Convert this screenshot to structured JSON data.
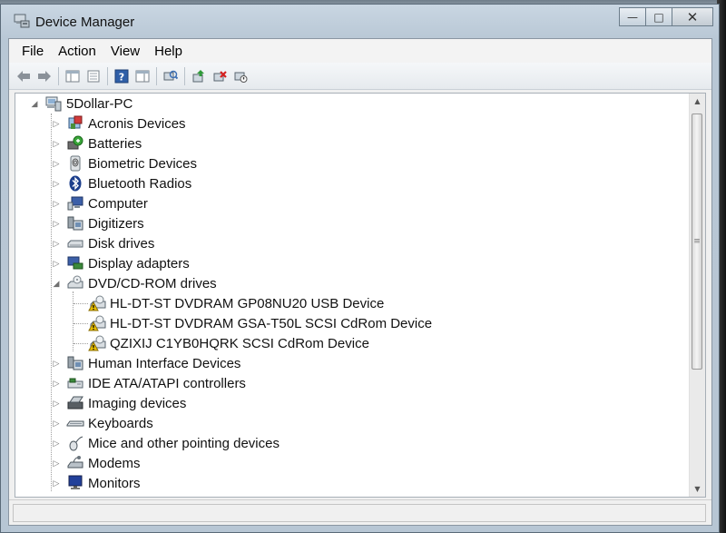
{
  "window": {
    "title": "Device Manager",
    "minimize_glyph": "—",
    "maximize_glyph": "□",
    "close_glyph": "✕"
  },
  "menubar": {
    "items": [
      "File",
      "Action",
      "View",
      "Help"
    ]
  },
  "toolbar": {
    "buttons": [
      {
        "icon": "back-arrow-icon"
      },
      {
        "icon": "forward-arrow-icon"
      },
      {
        "icon": "show-hide-console-tree-icon"
      },
      {
        "icon": "properties-icon"
      },
      {
        "icon": "help-icon"
      },
      {
        "icon": "show-hide-action-pane-icon"
      },
      {
        "icon": "scan-hardware-changes-icon"
      },
      {
        "icon": "update-driver-icon"
      },
      {
        "icon": "uninstall-icon"
      },
      {
        "icon": "disable-device-icon"
      }
    ]
  },
  "tree": {
    "root": {
      "label": "5Dollar-PC",
      "expanded": true,
      "icon": "computer-icon"
    },
    "categories": [
      {
        "label": "Acronis Devices",
        "icon": "acronis-devices-icon",
        "expanded": false
      },
      {
        "label": "Batteries",
        "icon": "battery-icon",
        "expanded": false
      },
      {
        "label": "Biometric Devices",
        "icon": "fingerprint-icon",
        "expanded": false
      },
      {
        "label": "Bluetooth Radios",
        "icon": "bluetooth-icon",
        "expanded": false
      },
      {
        "label": "Computer",
        "icon": "computer-monitor-icon",
        "expanded": false
      },
      {
        "label": "Digitizers",
        "icon": "digitizer-icon",
        "expanded": false
      },
      {
        "label": "Disk drives",
        "icon": "disk-drive-icon",
        "expanded": false
      },
      {
        "label": "Display adapters",
        "icon": "display-adapter-icon",
        "expanded": false
      },
      {
        "label": "DVD/CD-ROM drives",
        "icon": "dvd-drive-icon",
        "expanded": true,
        "children": [
          {
            "label": "HL-DT-ST DVDRAM GP08NU20 USB Device",
            "icon": "dvd-drive-warning-icon"
          },
          {
            "label": "HL-DT-ST DVDRAM GSA-T50L SCSI CdRom Device",
            "icon": "dvd-drive-warning-icon"
          },
          {
            "label": "QZIXIJ C1YB0HQRK SCSI CdRom Device",
            "icon": "dvd-drive-warning-icon"
          }
        ]
      },
      {
        "label": "Human Interface Devices",
        "icon": "hid-icon",
        "expanded": false
      },
      {
        "label": "IDE ATA/ATAPI controllers",
        "icon": "ide-controller-icon",
        "expanded": false
      },
      {
        "label": "Imaging devices",
        "icon": "imaging-device-icon",
        "expanded": false
      },
      {
        "label": "Keyboards",
        "icon": "keyboard-icon",
        "expanded": false
      },
      {
        "label": "Mice and other pointing devices",
        "icon": "mouse-icon",
        "expanded": false
      },
      {
        "label": "Modems",
        "icon": "modem-icon",
        "expanded": false
      },
      {
        "label": "Monitors",
        "icon": "monitor-icon",
        "expanded": false
      }
    ]
  },
  "colors": {
    "warning": "#e8c000",
    "accent": "#3c6fb4"
  }
}
